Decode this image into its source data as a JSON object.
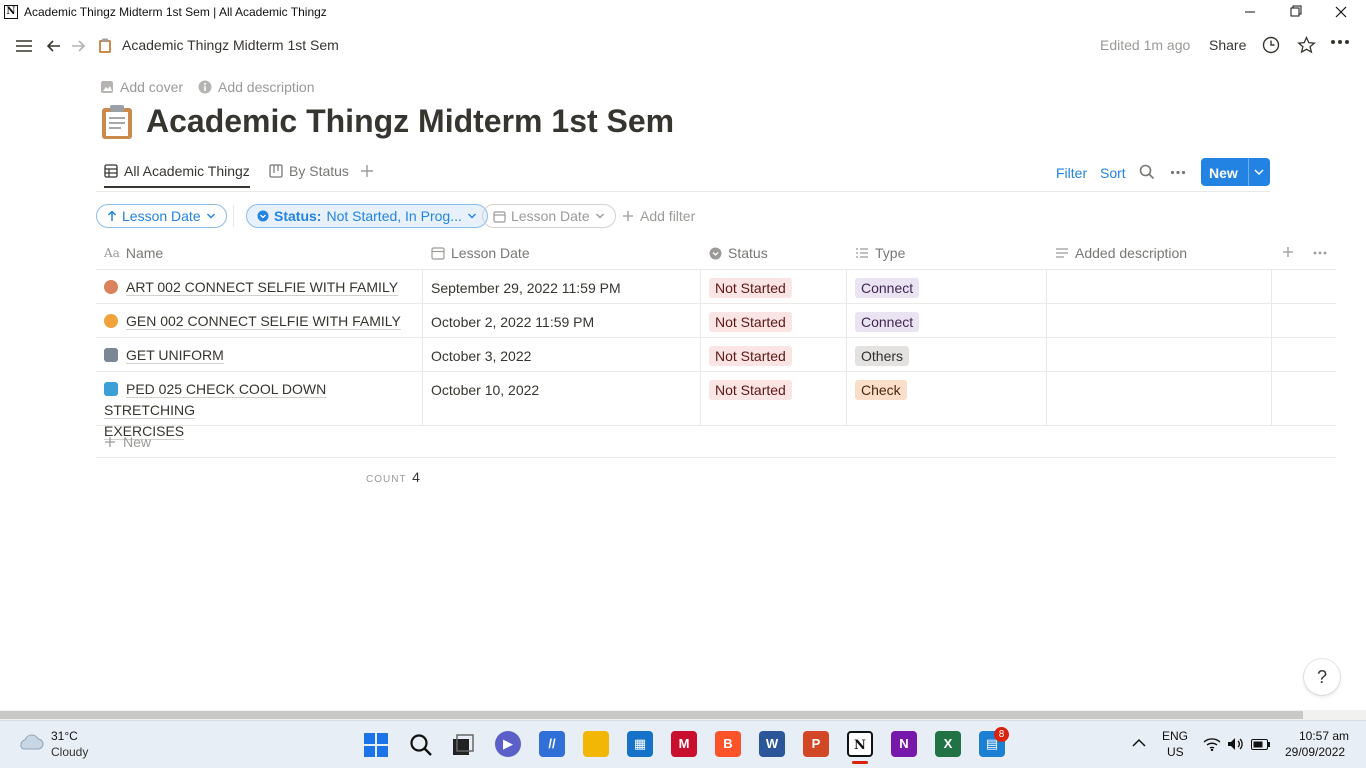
{
  "window": {
    "title": "Academic Thingz Midterm 1st Sem | All Academic Thingz",
    "app_icon": "N"
  },
  "topbar": {
    "breadcrumb": "Academic Thingz Midterm 1st Sem",
    "edited": "Edited 1m ago",
    "share": "Share"
  },
  "page": {
    "add_cover": "Add cover",
    "add_description": "Add description",
    "title": "Academic Thingz Midterm 1st Sem"
  },
  "views": {
    "tabs": [
      {
        "label": "All Academic Thingz",
        "active": true
      },
      {
        "label": "By Status",
        "active": false
      }
    ],
    "filter": "Filter",
    "sort": "Sort",
    "new_button": "New"
  },
  "filters": {
    "sort_chip": "Lesson Date",
    "status_chip_key": "Status:",
    "status_chip_value": "Not Started, In Prog...",
    "date_chip": "Lesson Date",
    "add_filter": "Add filter"
  },
  "table": {
    "columns": [
      "Name",
      "Lesson Date",
      "Status",
      "Type",
      "Added description"
    ],
    "rows": [
      {
        "name": "ART 002 CONNECT SELFIE WITH FAMILY",
        "date": "September 29, 2022 11:59 PM",
        "status": "Not Started",
        "type": "Connect",
        "emoji_color": "#d9825b"
      },
      {
        "name": "GEN 002 CONNECT SELFIE WITH FAMILY",
        "date": "October 2, 2022 11:59 PM",
        "status": "Not Started",
        "type": "Connect",
        "emoji_color": "#f0a23b"
      },
      {
        "name": "GET UNIFORM",
        "date": "October 3, 2022",
        "status": "Not Started",
        "type": "Others",
        "emoji_color": "#7b8794"
      },
      {
        "name": "PED 025 CHECK COOL DOWN STRETCHING",
        "name_cont": "EXERCISES",
        "date": "October 10, 2022",
        "status": "Not Started",
        "type": "Check",
        "emoji_color": "#3ba0d6"
      }
    ],
    "new_row": "New",
    "count_label": "COUNT",
    "count_value": "4"
  },
  "colors": {
    "accent": "#2383e2",
    "status_bg": "#fbe4e4",
    "status_fg": "#5d1715",
    "connect_bg": "#eae4f2",
    "connect_fg": "#412454",
    "others_bg": "#e3e2e0",
    "others_fg": "#32302c",
    "check_bg": "#fadec9",
    "check_fg": "#49290e"
  },
  "help": "?",
  "taskbar": {
    "weather_temp": "31°C",
    "weather_desc": "Cloudy",
    "lang": "ENG",
    "region": "US",
    "time": "10:57 am",
    "date": "29/09/2022",
    "badge": "8"
  }
}
